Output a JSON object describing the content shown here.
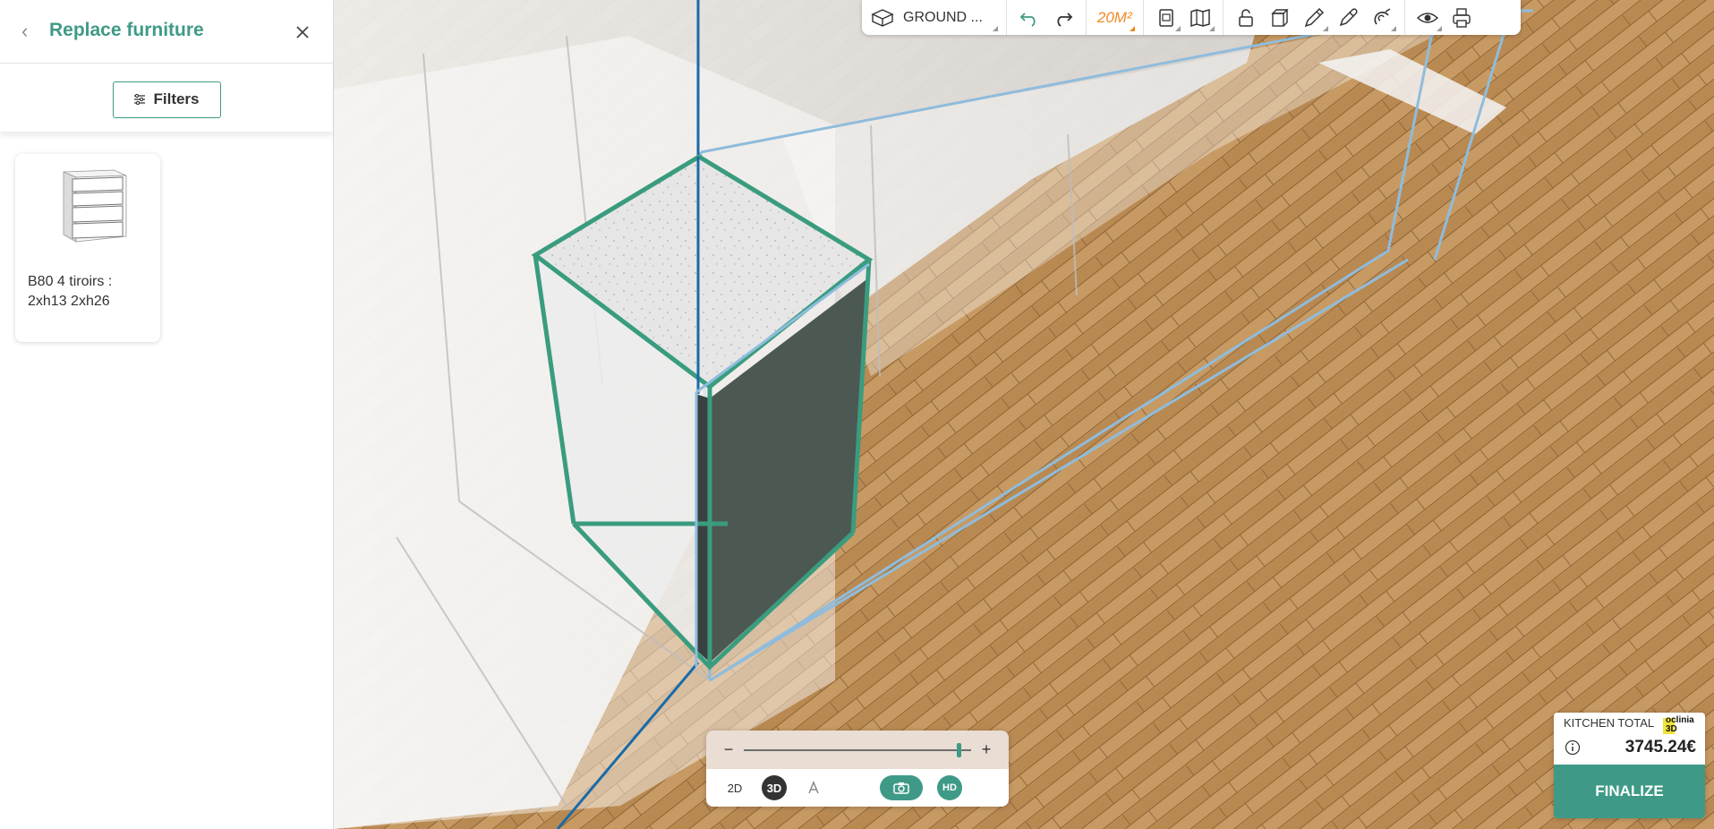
{
  "panel": {
    "title": "Replace furniture",
    "filters_label": "Filters",
    "items": [
      {
        "label": "B80 4 tiroirs :\n2xh13 2xh26"
      }
    ]
  },
  "toolbar": {
    "floor_label": "GROUND ...",
    "area_label": "20M²",
    "accent_color": "#f08a24"
  },
  "zoom": {
    "minus": "−",
    "plus": "+",
    "level": 0.95,
    "modes": {
      "two_d": "2D",
      "three_d": "3D"
    },
    "hd": "HD"
  },
  "total": {
    "label": "KITCHEN TOTAL",
    "brand": "oclinia\n3D",
    "value": "3745.24€",
    "finalize": "FINALIZE"
  },
  "colors": {
    "accent": "#3e9a86",
    "highlight_outline": "#3a9c7f",
    "selection_outline": "#8fbcdc"
  }
}
